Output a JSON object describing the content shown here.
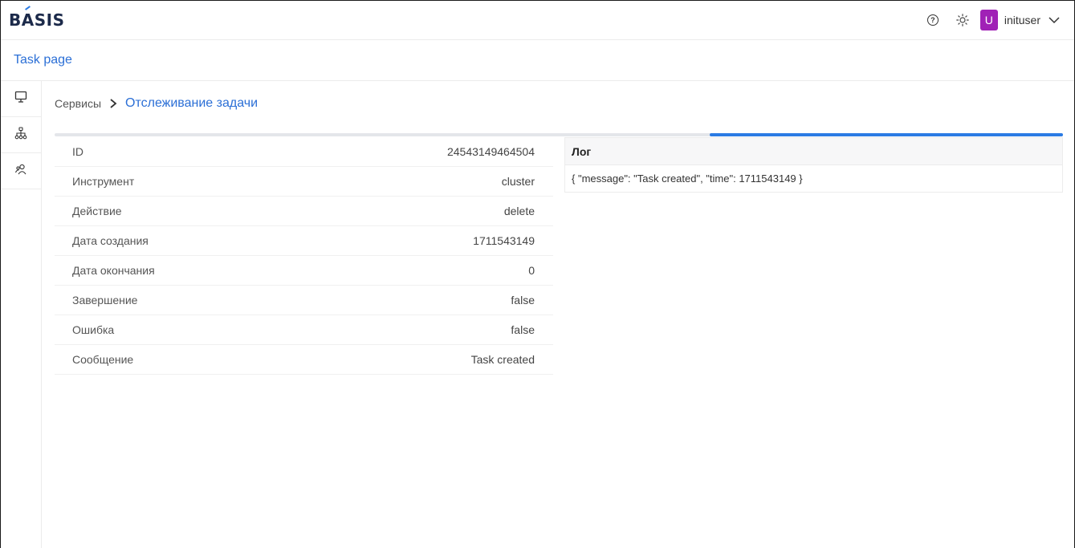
{
  "app": {
    "logo_text_pre": "B",
    "logo_text_accent": "A",
    "logo_text_post": "SIS",
    "accent_color": "#2b7be4",
    "avatar_color": "#a021b6"
  },
  "topbar": {
    "help_icon": "help-circle-icon",
    "theme_icon": "sun-icon",
    "avatar_letter": "U",
    "username": "inituser",
    "menu_icon": "chevron-down-icon"
  },
  "page": {
    "title": "Task page"
  },
  "sidebar": {
    "items": [
      {
        "icon": "monitor-icon"
      },
      {
        "icon": "network-icon"
      },
      {
        "icon": "users-icon"
      }
    ]
  },
  "breadcrumb": {
    "root": "Сервисы",
    "current": "Отслеживание задачи"
  },
  "progress": {
    "filled_from": 0.65,
    "filled_to": 1.0
  },
  "task": {
    "rows": [
      {
        "label": "ID",
        "value": "24543149464504"
      },
      {
        "label": "Инструмент",
        "value": "cluster"
      },
      {
        "label": "Действие",
        "value": "delete"
      },
      {
        "label": "Дата создания",
        "value": "1711543149"
      },
      {
        "label": "Дата окончания",
        "value": "0"
      },
      {
        "label": "Завершение",
        "value": "false"
      },
      {
        "label": "Ошибка",
        "value": "false"
      },
      {
        "label": "Сообщение",
        "value": "Task created"
      }
    ]
  },
  "log": {
    "header": "Лог",
    "entries": [
      "{ \"message\": \"Task created\", \"time\": 1711543149 }"
    ]
  }
}
